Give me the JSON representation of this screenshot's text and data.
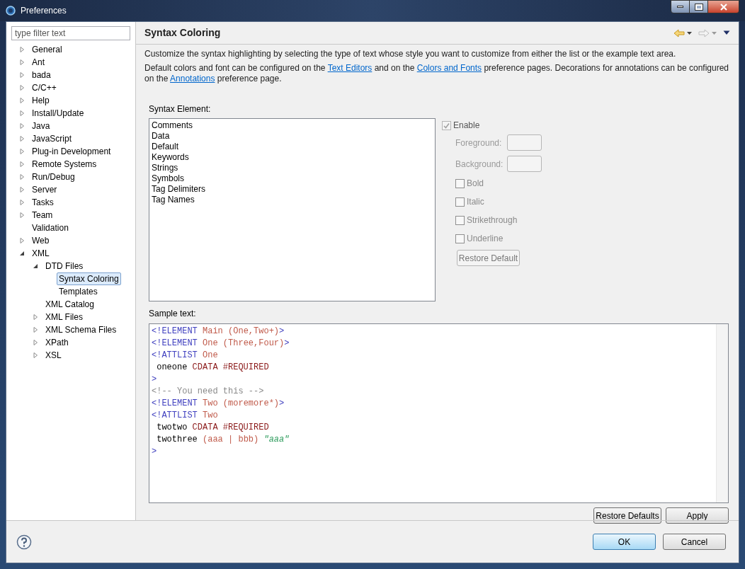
{
  "window": {
    "title": "Preferences"
  },
  "filter": {
    "placeholder": "type filter text"
  },
  "tree": [
    {
      "label": "General",
      "kind": "folder",
      "expanded": false,
      "selected": false
    },
    {
      "label": "Ant",
      "kind": "folder",
      "expanded": false,
      "selected": false
    },
    {
      "label": "bada",
      "kind": "folder",
      "expanded": false,
      "selected": false
    },
    {
      "label": "C/C++",
      "kind": "folder",
      "expanded": false,
      "selected": false
    },
    {
      "label": "Help",
      "kind": "folder",
      "expanded": false,
      "selected": false
    },
    {
      "label": "Install/Update",
      "kind": "folder",
      "expanded": false,
      "selected": false
    },
    {
      "label": "Java",
      "kind": "folder",
      "expanded": false,
      "selected": false
    },
    {
      "label": "JavaScript",
      "kind": "folder",
      "expanded": false,
      "selected": false
    },
    {
      "label": "Plug-in Development",
      "kind": "folder",
      "expanded": false,
      "selected": false
    },
    {
      "label": "Remote Systems",
      "kind": "folder",
      "expanded": false,
      "selected": false
    },
    {
      "label": "Run/Debug",
      "kind": "folder",
      "expanded": false,
      "selected": false
    },
    {
      "label": "Server",
      "kind": "folder",
      "expanded": false,
      "selected": false
    },
    {
      "label": "Tasks",
      "kind": "folder",
      "expanded": false,
      "selected": false
    },
    {
      "label": "Team",
      "kind": "folder",
      "expanded": false,
      "selected": false
    },
    {
      "label": "Validation",
      "kind": "leaf",
      "selected": false
    },
    {
      "label": "Web",
      "kind": "folder",
      "expanded": false,
      "selected": false
    },
    {
      "label": "XML",
      "kind": "folder",
      "expanded": true,
      "selected": false,
      "children": [
        {
          "label": "DTD Files",
          "kind": "folder",
          "expanded": true,
          "selected": false,
          "children": [
            {
              "label": "Syntax Coloring",
              "kind": "leaf",
              "selected": true
            },
            {
              "label": "Templates",
              "kind": "leaf",
              "selected": false
            }
          ]
        },
        {
          "label": "XML Catalog",
          "kind": "leaf",
          "selected": false
        },
        {
          "label": "XML Files",
          "kind": "folder",
          "expanded": false,
          "selected": false
        },
        {
          "label": "XML Schema Files",
          "kind": "folder",
          "expanded": false,
          "selected": false
        },
        {
          "label": "XPath",
          "kind": "folder",
          "expanded": false,
          "selected": false
        },
        {
          "label": "XSL",
          "kind": "folder",
          "expanded": false,
          "selected": false
        }
      ]
    }
  ],
  "page": {
    "title": "Syntax Coloring",
    "intro": "Customize the syntax highlighting by selecting the type of text whose style you want to customize from either the list or the example text area.",
    "links_text": [
      {
        "kind": "text",
        "text": "Default colors and font can be configured on the "
      },
      {
        "kind": "link",
        "text": "Text Editors"
      },
      {
        "kind": "text",
        "text": " and on the "
      },
      {
        "kind": "link",
        "text": "Colors and Fonts"
      },
      {
        "kind": "text",
        "text": " preference pages.  Decorations for annotations can be configured on the "
      },
      {
        "kind": "link",
        "text": "Annotations"
      },
      {
        "kind": "text",
        "text": " preference page."
      }
    ],
    "element_label": "Syntax Element:",
    "elements": [
      {
        "label": "Comments",
        "selected": false
      },
      {
        "label": "Data",
        "selected": false
      },
      {
        "label": "Default",
        "selected": false
      },
      {
        "label": "Keywords",
        "selected": false
      },
      {
        "label": "Strings",
        "selected": false
      },
      {
        "label": "Symbols",
        "selected": false
      },
      {
        "label": "Tag Delimiters",
        "selected": false
      },
      {
        "label": "Tag Names",
        "selected": false
      }
    ],
    "enable": {
      "label": "Enable",
      "checked": true,
      "disabled": true
    },
    "foreground": {
      "label": "Foreground:"
    },
    "background": {
      "label": "Background:"
    },
    "styles": [
      {
        "label": "Bold",
        "checked": false
      },
      {
        "label": "Italic",
        "checked": false
      },
      {
        "label": "Strikethrough",
        "checked": false
      },
      {
        "label": "Underline",
        "checked": false
      }
    ],
    "restore_default": "Restore Default",
    "sample_label": "Sample text:",
    "sample": [
      [
        {
          "kind": "tag",
          "text": "<!ELEMENT"
        },
        {
          "kind": "name",
          "text": " Main"
        },
        {
          "kind": "name",
          "text": " (One,Two+)"
        },
        {
          "kind": "tag",
          "text": ">"
        }
      ],
      [
        {
          "kind": "tag",
          "text": "<!ELEMENT"
        },
        {
          "kind": "name",
          "text": " One"
        },
        {
          "kind": "name",
          "text": " (Three,Four)"
        },
        {
          "kind": "tag",
          "text": ">"
        }
      ],
      [
        {
          "kind": "tag",
          "text": "<!ATTLIST"
        },
        {
          "kind": "name",
          "text": " One"
        }
      ],
      [
        {
          "kind": "plain",
          "text": " oneone "
        },
        {
          "kind": "keyword",
          "text": "CDATA #REQUIRED"
        }
      ],
      [
        {
          "kind": "tag",
          "text": ">"
        }
      ],
      [
        {
          "kind": "comment",
          "text": "<!-- You need this -->"
        }
      ],
      [
        {
          "kind": "tag",
          "text": "<!ELEMENT"
        },
        {
          "kind": "name",
          "text": " Two"
        },
        {
          "kind": "name",
          "text": " (moremore*)"
        },
        {
          "kind": "tag",
          "text": ">"
        }
      ],
      [
        {
          "kind": "tag",
          "text": "<!ATTLIST"
        },
        {
          "kind": "name",
          "text": " Two"
        }
      ],
      [
        {
          "kind": "plain",
          "text": " twotwo "
        },
        {
          "kind": "keyword",
          "text": "CDATA #REQUIRED"
        }
      ],
      [
        {
          "kind": "plain",
          "text": " twothree "
        },
        {
          "kind": "name",
          "text": "(aaa | bbb)"
        },
        {
          "kind": "string",
          "text": " \"aaa\""
        }
      ],
      [
        {
          "kind": "tag",
          "text": ">"
        }
      ]
    ]
  },
  "buttons": {
    "restore_defaults": "Restore Defaults",
    "apply": "Apply",
    "ok": "OK",
    "cancel": "Cancel"
  }
}
